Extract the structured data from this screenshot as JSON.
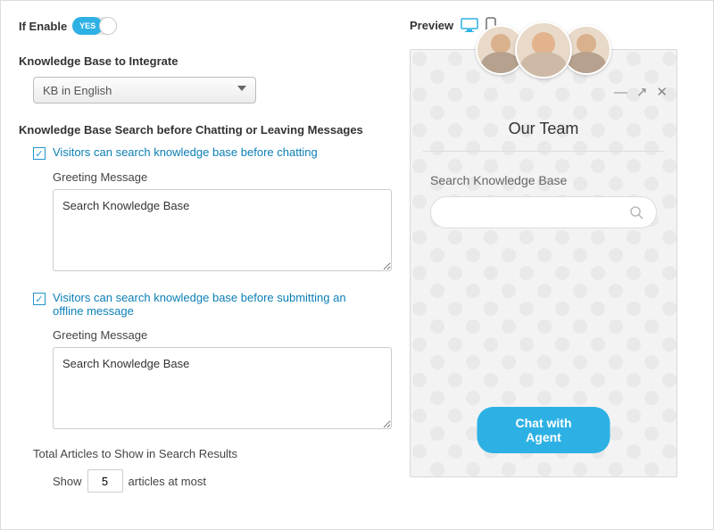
{
  "header": {
    "if_enable_label": "If Enable",
    "toggle_text": "YES",
    "preview_label": "Preview"
  },
  "kb_integrate": {
    "title": "Knowledge Base to Integrate",
    "selected": "KB in English"
  },
  "kb_search": {
    "title": "Knowledge Base Search before Chatting or Leaving Messages",
    "chat_checkbox_label": "Visitors can search knowledge base before chatting",
    "greeting_label_1": "Greeting Message",
    "greeting_value_1": "Search Knowledge Base",
    "offline_checkbox_label": "Visitors can search knowledge base before submitting an offline message",
    "greeting_label_2": "Greeting Message",
    "greeting_value_2": "Search Knowledge Base"
  },
  "results": {
    "title": "Total Articles to Show in Search Results",
    "show_prefix": "Show",
    "show_value": "5",
    "show_suffix": "articles at most"
  },
  "widget": {
    "title": "Our Team",
    "kb_label": "Search Knowledge Base",
    "chat_button": "Chat with Agent"
  }
}
